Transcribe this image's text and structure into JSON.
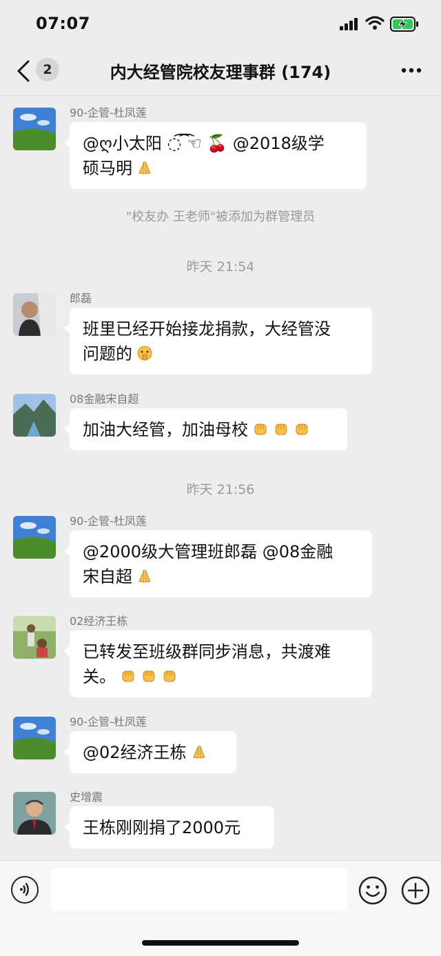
{
  "status_bar": {
    "time": "07:07"
  },
  "header": {
    "back_badge": "2",
    "title": "内大经管院校友理事群 (174)"
  },
  "system_notice": "\"校友办 王老师\"被添加为群管理员",
  "timestamps": [
    "昨天 21:54",
    "昨天 21:56"
  ],
  "messages": [
    {
      "sender": "90-企管-杜凤莲",
      "line1": "@ღ小太阳 ◌͡ ͡☜ 🍒 @2018级学",
      "line2": "硕马明",
      "emoji": "pray"
    },
    {
      "sender": "郎磊",
      "line1": "班里已经开始接龙捐款，大经管没",
      "line2": "问题的",
      "emoji": "shush"
    },
    {
      "sender": "08金融宋自超",
      "line1": "加油大经管，加油母校",
      "emoji": "fist"
    },
    {
      "sender": "90-企管-杜凤莲",
      "line1": "@2000级大管理班郎磊 @08金融",
      "line2": "宋自超",
      "emoji": "pray"
    },
    {
      "sender": "02经济王栋",
      "line1": "已转发至班级群同步消息，共渡难",
      "line2": "关。",
      "emoji": "fist"
    },
    {
      "sender": "90-企管-杜凤莲",
      "line1": "@02经济王栋",
      "emoji": "pray"
    },
    {
      "sender": "史增震",
      "line1": "王栋刚刚捐了2000元"
    }
  ],
  "colors": {
    "background": "#ededed",
    "bubble": "#ffffff",
    "battery": "#35c759"
  }
}
